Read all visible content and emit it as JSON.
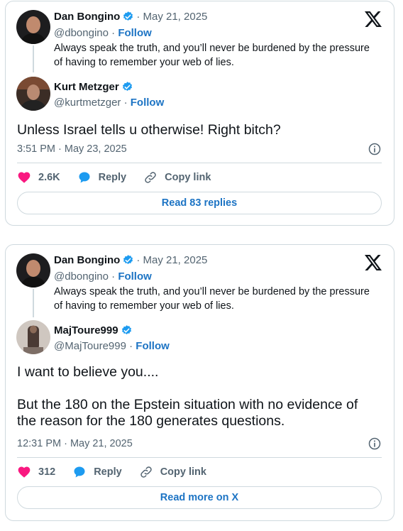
{
  "colors": {
    "accent": "#1d74c4",
    "muted": "#536471",
    "text": "#0f1419",
    "border": "#cfd9de",
    "like": "#f91880",
    "verified": "#1d9bf0"
  },
  "cards": [
    {
      "parent": {
        "name": "Dan Bongino",
        "date": "· May 21, 2025",
        "handle": "@dbongino",
        "separator": "·",
        "follow": "Follow",
        "text_line1": "Always speak the truth, and you’ll never be burdened by the pressure",
        "text_line2": "of having to remember your web of lies."
      },
      "reply": {
        "name": "Kurt Metzger",
        "handle": "@kurtmetzger",
        "separator": "·",
        "follow": "Follow",
        "text_line1": "Unless Israel tells u otherwise! Right bitch?",
        "timestamp": "3:51 PM · May 23, 2025"
      },
      "actions": {
        "likes": "2.6K",
        "reply": "Reply",
        "copy": "Copy link"
      },
      "read_button": "Read 83 replies"
    },
    {
      "parent": {
        "name": "Dan Bongino",
        "date": "· May 21, 2025",
        "handle": "@dbongino",
        "separator": "·",
        "follow": "Follow",
        "text_line1": "Always speak the truth, and you’ll never be burdened by the pressure",
        "text_line2": "of having to remember your web of lies."
      },
      "reply": {
        "name": "MajToure999",
        "handle": "@MajToure999",
        "separator": "·",
        "follow": "Follow",
        "text_line1": "I want to believe you....",
        "text_line2": "But the 180 on the Epstein situation with no evidence of",
        "text_line3": "the reason for the 180 generates questions.",
        "timestamp": "12:31 PM · May 21, 2025"
      },
      "actions": {
        "likes": "312",
        "reply": "Reply",
        "copy": "Copy link"
      },
      "read_button": "Read more on X"
    }
  ]
}
